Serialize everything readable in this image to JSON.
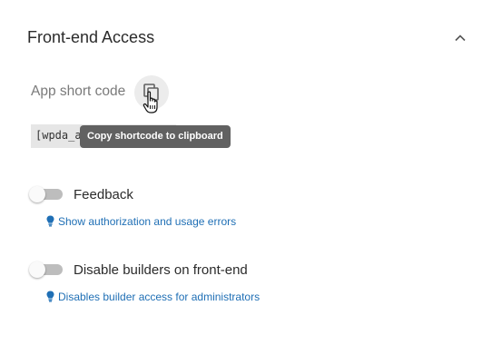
{
  "section": {
    "title": "Front-end Access",
    "collapse_icon": "chevron-up-icon"
  },
  "shortcode": {
    "label": "App short code",
    "value": "[wpda_a",
    "copy_icon": "copy-icon",
    "tooltip": "Copy shortcode to clipboard"
  },
  "options": [
    {
      "label": "Feedback",
      "enabled": false,
      "hint": "Show authorization and usage errors",
      "hint_icon": "lightbulb-icon"
    },
    {
      "label": "Disable builders on front-end",
      "enabled": false,
      "hint": "Disables builder access for administrators",
      "hint_icon": "lightbulb-icon"
    }
  ],
  "colors": {
    "hint_link": "#1f6fb5",
    "toggle_off_track": "#bdbdbd",
    "tooltip_bg": "#616161"
  }
}
